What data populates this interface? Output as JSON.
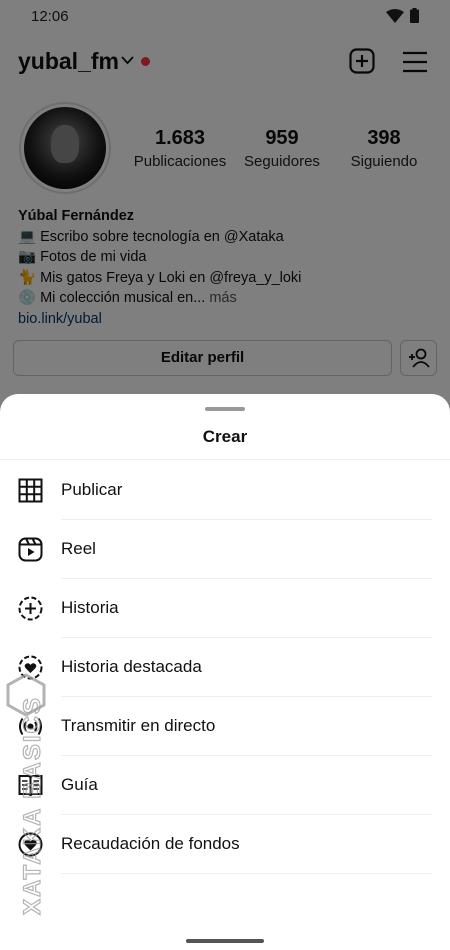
{
  "status": {
    "time": "12:06"
  },
  "profile": {
    "username": "yubal_fm",
    "stats": [
      {
        "value": "1.683",
        "label": "Publicaciones"
      },
      {
        "value": "959",
        "label": "Seguidores"
      },
      {
        "value": "398",
        "label": "Siguiendo"
      }
    ],
    "bio": {
      "name": "Yúbal Fernández",
      "line1": "💻 Escribo sobre tecnología en @Xataka",
      "line2": "📷 Fotos de mi vida",
      "line3": "🐈 Mis gatos Freya y Loki en @freya_y_loki",
      "line4": "💿 Mi colección musical en...",
      "more": " más",
      "link": "bio.link/yubal"
    },
    "edit_button": "Editar perfil"
  },
  "sheet": {
    "title": "Crear",
    "items": [
      {
        "label": "Publicar",
        "icon": "grid-icon"
      },
      {
        "label": "Reel",
        "icon": "reel-icon"
      },
      {
        "label": "Historia",
        "icon": "story-add-icon"
      },
      {
        "label": "Historia destacada",
        "icon": "highlight-heart-icon"
      },
      {
        "label": "Transmitir en directo",
        "icon": "live-broadcast-icon"
      },
      {
        "label": "Guía",
        "icon": "guide-book-icon"
      },
      {
        "label": "Recaudación de fondos",
        "icon": "fundraiser-heart-icon"
      }
    ]
  },
  "watermark": {
    "text": "XATAKA BASICS"
  },
  "colors": {
    "accent_dot": "#ff3040",
    "link": "#00376b"
  }
}
